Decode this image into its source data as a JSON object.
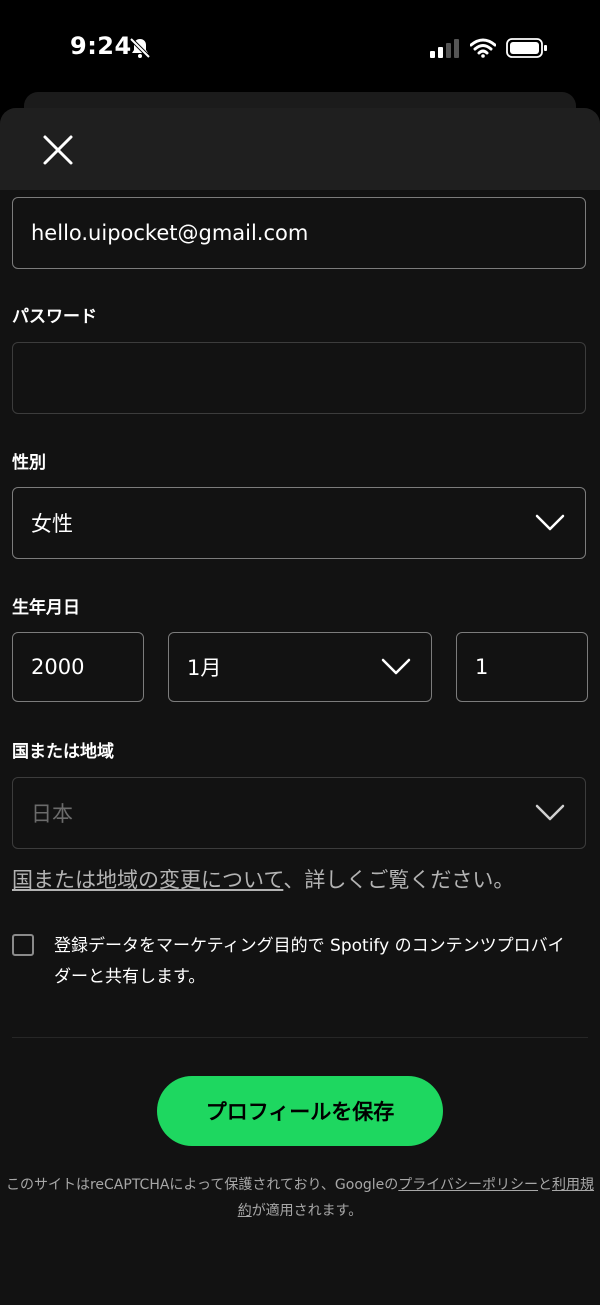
{
  "status": {
    "time": "9:24"
  },
  "form": {
    "email_value": "hello.uipocket@gmail.com",
    "password_label": "パスワード",
    "password_value": "",
    "gender_label": "性別",
    "gender_value": "女性",
    "birthday_label": "生年月日",
    "birth_year": "2000",
    "birth_month": "1月",
    "birth_day": "1",
    "country_label": "国または地域",
    "country_value": "日本"
  },
  "help": {
    "link_text": "国または地域の変更について",
    "rest_text": "、詳しくご覧ください。"
  },
  "consent": {
    "text": "登録データをマーケティング目的で Spotify のコンテンツプロバイダーと共有します。",
    "checked": false
  },
  "actions": {
    "save_label": "プロフィールを保存"
  },
  "footer": {
    "prefix": "このサイトはreCAPTCHAによって保護されており、Googleの",
    "privacy_link": "プライバシーポリシー",
    "middle": "と",
    "terms_link": "利用規約",
    "suffix": "が適用されます。"
  },
  "colors": {
    "accent": "#1ed760",
    "background": "#121212",
    "header": "#1f1f1f"
  },
  "icons": [
    "bell-slash-icon",
    "signal-icon",
    "wifi-icon",
    "battery-icon",
    "close-icon",
    "chevron-down-icon"
  ]
}
